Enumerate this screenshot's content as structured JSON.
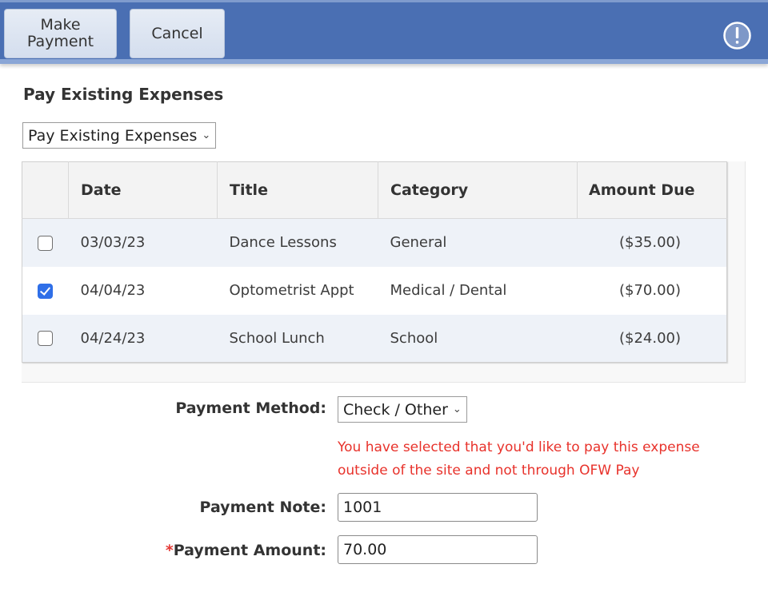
{
  "toolbar": {
    "make_payment_label": "Make Payment",
    "cancel_label": "Cancel",
    "alert_icon": "exclamation-circle-icon"
  },
  "page": {
    "title": "Pay Existing Expenses",
    "mode_select": {
      "selected": "Pay Existing Expenses"
    }
  },
  "table": {
    "columns": [
      "",
      "Date",
      "Title",
      "Category",
      "Amount Due"
    ],
    "rows": [
      {
        "checked": false,
        "date": "03/03/23",
        "title": "Dance Lessons",
        "category": "General",
        "amount": "($35.00)"
      },
      {
        "checked": true,
        "date": "04/04/23",
        "title": "Optometrist Appt",
        "category": "Medical / Dental",
        "amount": "($70.00)"
      },
      {
        "checked": false,
        "date": "04/24/23",
        "title": "School Lunch",
        "category": "School",
        "amount": "($24.00)"
      }
    ]
  },
  "form": {
    "payment_method": {
      "label": "Payment Method:",
      "selected": "Check / Other"
    },
    "warning": "You have selected that you'd like to pay this expense outside of the site and not through OFW Pay",
    "payment_note": {
      "label": "Payment Note:",
      "value": "1001"
    },
    "payment_amount": {
      "required_marker": "*",
      "label": "Payment Amount:",
      "value": "70.00"
    }
  },
  "colors": {
    "toolbar_bg": "#4a6fb3",
    "checkbox_checked": "#2f6fe8",
    "warning_text": "#e8322b",
    "row_alt_bg": "#eef2f8"
  }
}
